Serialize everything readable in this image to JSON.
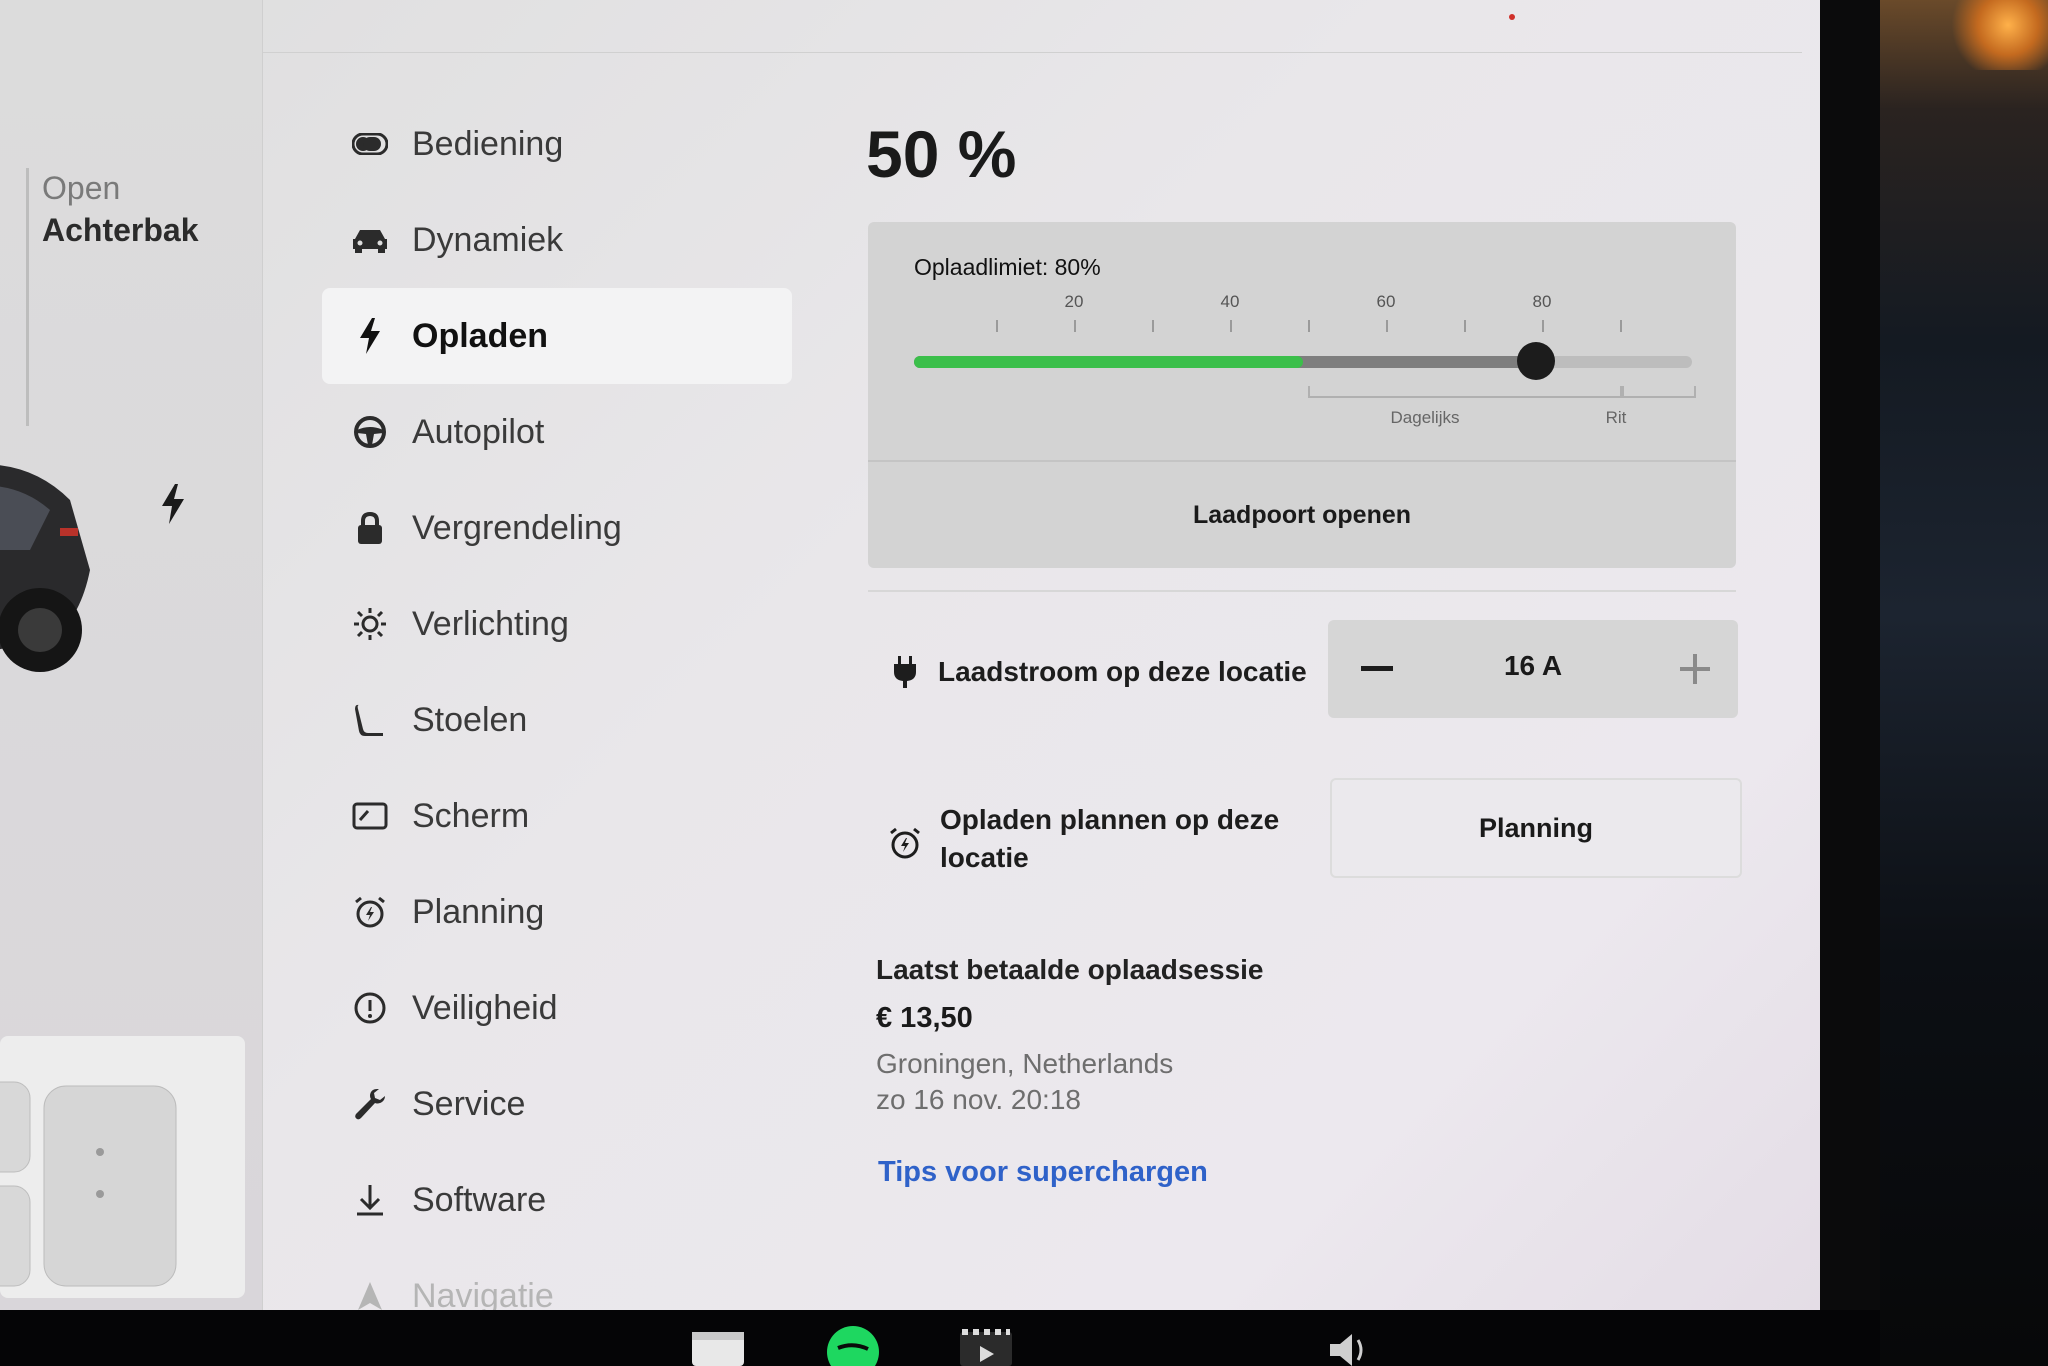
{
  "car_panel": {
    "trunk_status": "Open",
    "trunk_label": "Achterbak"
  },
  "menu": {
    "items": [
      {
        "label": "Bediening",
        "icon": "toggle-icon"
      },
      {
        "label": "Dynamiek",
        "icon": "car-icon"
      },
      {
        "label": "Opladen",
        "icon": "lightning-icon",
        "active": true
      },
      {
        "label": "Autopilot",
        "icon": "steering-wheel-icon"
      },
      {
        "label": "Vergrendeling",
        "icon": "lock-icon"
      },
      {
        "label": "Verlichting",
        "icon": "sun-icon"
      },
      {
        "label": "Stoelen",
        "icon": "seat-icon"
      },
      {
        "label": "Scherm",
        "icon": "display-icon"
      },
      {
        "label": "Planning",
        "icon": "alarm-clock-icon"
      },
      {
        "label": "Veiligheid",
        "icon": "alert-circle-icon"
      },
      {
        "label": "Service",
        "icon": "wrench-icon"
      },
      {
        "label": "Software",
        "icon": "download-icon"
      },
      {
        "label": "Navigatie",
        "icon": "navigation-arrow-icon"
      }
    ]
  },
  "charging": {
    "battery_percent": "50 %",
    "battery_level": 0.5,
    "limit_label": "Oplaadlimiet: 80%",
    "limit_value": 0.8,
    "tick_labels": [
      "20",
      "40",
      "60",
      "80"
    ],
    "range_labels": {
      "daily": "Dagelijks",
      "trip": "Rit"
    },
    "open_port_button": "Laadpoort openen",
    "current_label": "Laadstroom op deze locatie",
    "current_value": "16  A",
    "schedule_label_line1": "Opladen plannen op deze",
    "schedule_label_line2": "locatie",
    "schedule_button": "Planning"
  },
  "session": {
    "title": "Laatst betaalde oplaadsessie",
    "amount": "€ 13,50",
    "location": "Groningen, Netherlands",
    "datetime": "zo 16 nov. 20:18",
    "tips_link": "Tips voor superchargen"
  },
  "colors": {
    "charge_green": "#3bbf4a",
    "link_blue": "#2f62c9",
    "knob": "#1c1c1c"
  }
}
